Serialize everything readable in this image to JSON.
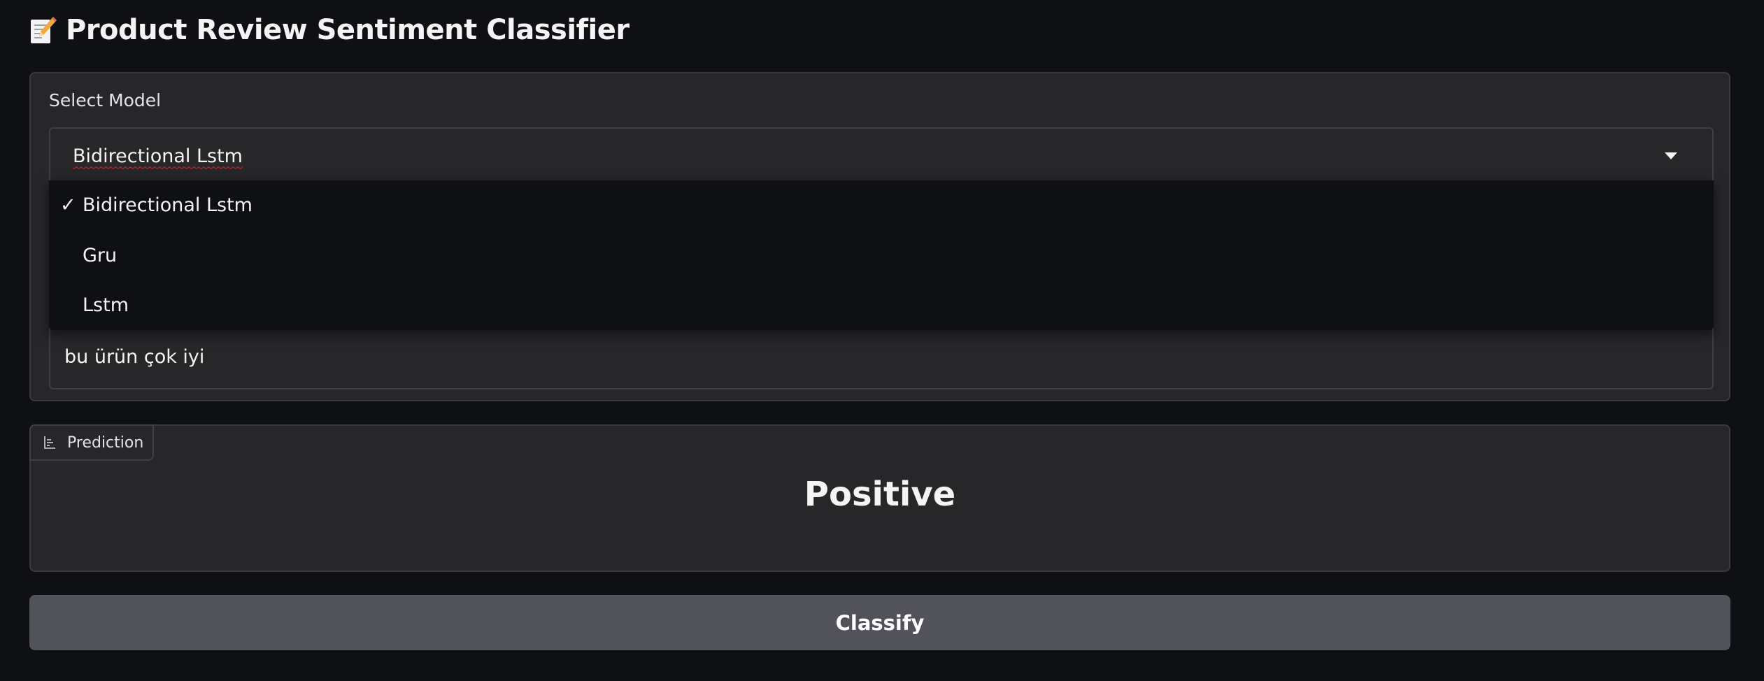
{
  "app": {
    "title_icon": "memo-icon",
    "title": "Product Review Sentiment Classifier"
  },
  "model_select": {
    "label": "Select Model",
    "selected_value": "Bidirectional Lstm",
    "options": [
      {
        "label": "Bidirectional Lstm",
        "selected": true,
        "check": "✓"
      },
      {
        "label": "Gru",
        "selected": false
      },
      {
        "label": "Lstm",
        "selected": false
      }
    ]
  },
  "review": {
    "value": "bu ürün çok iyi"
  },
  "prediction": {
    "tab_label": "Prediction",
    "tab_icon": "bar-chart-icon",
    "value": "Positive"
  },
  "actions": {
    "classify_label": "Classify"
  },
  "colors": {
    "background": "#0f1013",
    "panel": "#27272a",
    "button": "#52525b"
  }
}
